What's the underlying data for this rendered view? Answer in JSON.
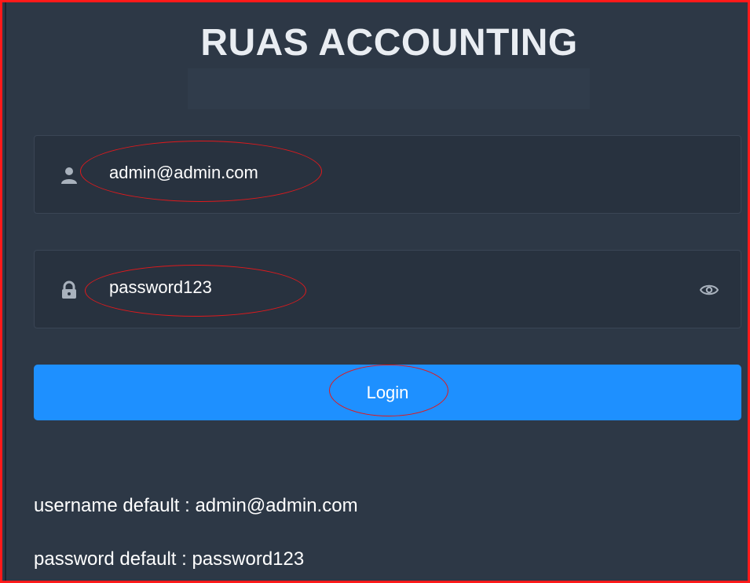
{
  "app": {
    "title": "RUAS ACCOUNTING"
  },
  "form": {
    "username": {
      "value": "admin@admin.com",
      "icon": "user-icon"
    },
    "password": {
      "value": "password123",
      "icon": "lock-icon",
      "toggle_icon": "eye-icon"
    },
    "login_label": "Login"
  },
  "hints": {
    "username_default": "username default : admin@admin.com",
    "password_default": "password default : password123"
  },
  "colors": {
    "background": "#2d3846",
    "field_background": "#28323f",
    "button": "#1e90ff",
    "annotation": "#e0191c",
    "frame_border": "#ff1a1a"
  }
}
